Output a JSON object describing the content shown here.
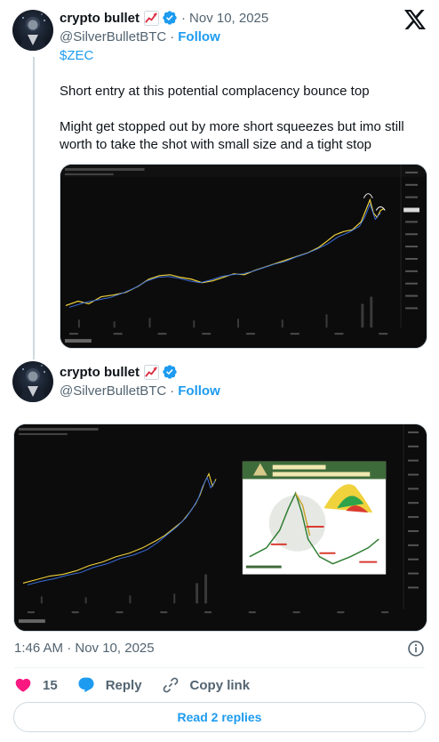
{
  "tweet1": {
    "display_name": "crypto bullet",
    "separator": "·",
    "date": "Nov 10, 2025",
    "handle": "@SilverBulletBTC",
    "dot": "·",
    "follow_label": "Follow",
    "cashtag": "$ZEC",
    "paragraph1": "Short entry at this potential complacency bounce top",
    "paragraph2": "Might get stopped out by more short squeezes but imo still worth to take the shot with small size and a tight stop",
    "media_icon": "tradingview-chart"
  },
  "tweet2": {
    "display_name": "crypto bullet",
    "handle": "@SilverBulletBTC",
    "dot": "·",
    "follow_label": "Follow",
    "media_icon": "tradingview-chart-with-market-cycle-inset"
  },
  "footer": {
    "timestamp": "1:46 AM · Nov 10, 2025",
    "like_count": "15",
    "reply_label": "Reply",
    "copy_link_label": "Copy link",
    "read_replies_label": "Read 2 replies"
  },
  "icons": {
    "brand": "x-logo",
    "verified": "verified-badge-icon",
    "emoji": "chart-increasing-emoji",
    "info": "info-icon",
    "like": "heart-icon",
    "reply": "reply-bubble-icon",
    "link": "link-icon"
  },
  "colors": {
    "accent": "#1d9bf0",
    "like": "#f91880",
    "muted": "#536471",
    "text": "#0f1419"
  }
}
